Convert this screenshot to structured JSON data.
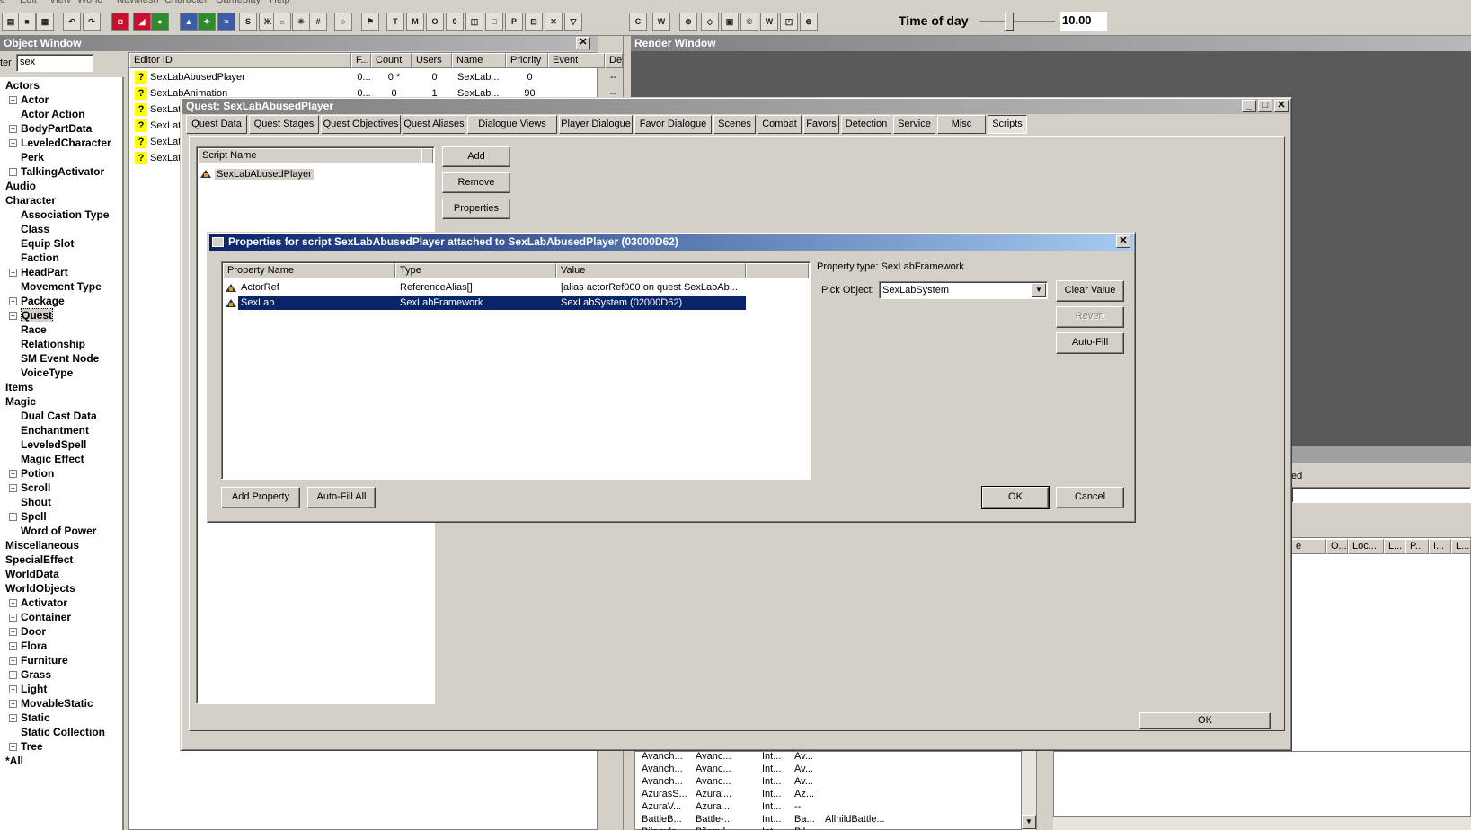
{
  "menu": {
    "items": [
      "e",
      "Edit",
      "View",
      "World",
      "NavMesh",
      "Character",
      "Gameplay",
      "Help"
    ]
  },
  "toolbar": {
    "time_of_day_label": "Time of day",
    "time_of_day_value": "10.00",
    "icons": [
      "open-icon",
      "save-icon",
      "preferences-icon",
      "undo-icon",
      "redo-icon",
      "select-icon",
      "landscape-edit-icon",
      "trees-icon",
      "sky-icon",
      "lighting-icon",
      "water-icon",
      "shk-icon",
      "dialogue-icon",
      "bulb-icon",
      "snap-icon",
      "grid-icon",
      "speech-icon",
      "marker-icon",
      "t-icon",
      "m-icon",
      "o-icon",
      "0-icon",
      "cube-icon",
      "box-icon",
      "p-icon",
      "portal-icon",
      "x-icon",
      "nav-icon",
      "c-icon",
      "w-icon",
      "misc-icon"
    ]
  },
  "object_window": {
    "title": "Object Window",
    "filter_label": "ter",
    "filter_value": "sex",
    "tree": [
      {
        "label": "Actors",
        "indent": 0,
        "expand": false
      },
      {
        "label": "Actor",
        "indent": 1,
        "expand": true
      },
      {
        "label": "Actor Action",
        "indent": 1,
        "expand": false
      },
      {
        "label": "BodyPartData",
        "indent": 1,
        "expand": true
      },
      {
        "label": "LeveledCharacter",
        "indent": 1,
        "expand": true
      },
      {
        "label": "Perk",
        "indent": 1,
        "expand": false
      },
      {
        "label": "TalkingActivator",
        "indent": 1,
        "expand": true
      },
      {
        "label": "Audio",
        "indent": 0,
        "expand": false
      },
      {
        "label": "Character",
        "indent": 0,
        "expand": false
      },
      {
        "label": "Association Type",
        "indent": 1,
        "expand": false
      },
      {
        "label": "Class",
        "indent": 1,
        "expand": false
      },
      {
        "label": "Equip Slot",
        "indent": 1,
        "expand": false
      },
      {
        "label": "Faction",
        "indent": 1,
        "expand": false
      },
      {
        "label": "HeadPart",
        "indent": 1,
        "expand": true
      },
      {
        "label": "Movement Type",
        "indent": 1,
        "expand": false
      },
      {
        "label": "Package",
        "indent": 1,
        "expand": true
      },
      {
        "label": "Quest",
        "indent": 1,
        "expand": true,
        "selected": true
      },
      {
        "label": "Race",
        "indent": 1,
        "expand": false
      },
      {
        "label": "Relationship",
        "indent": 1,
        "expand": false
      },
      {
        "label": "SM Event Node",
        "indent": 1,
        "expand": false
      },
      {
        "label": "VoiceType",
        "indent": 1,
        "expand": false
      },
      {
        "label": "Items",
        "indent": 0,
        "expand": false
      },
      {
        "label": "Magic",
        "indent": 0,
        "expand": false
      },
      {
        "label": "Dual Cast Data",
        "indent": 1,
        "expand": false
      },
      {
        "label": "Enchantment",
        "indent": 1,
        "expand": false
      },
      {
        "label": "LeveledSpell",
        "indent": 1,
        "expand": false
      },
      {
        "label": "Magic Effect",
        "indent": 1,
        "expand": false
      },
      {
        "label": "Potion",
        "indent": 1,
        "expand": true
      },
      {
        "label": "Scroll",
        "indent": 1,
        "expand": true
      },
      {
        "label": "Shout",
        "indent": 1,
        "expand": false
      },
      {
        "label": "Spell",
        "indent": 1,
        "expand": true
      },
      {
        "label": "Word of Power",
        "indent": 1,
        "expand": false
      },
      {
        "label": "Miscellaneous",
        "indent": 0,
        "expand": false
      },
      {
        "label": "SpecialEffect",
        "indent": 0,
        "expand": false
      },
      {
        "label": "WorldData",
        "indent": 0,
        "expand": false
      },
      {
        "label": "WorldObjects",
        "indent": 0,
        "expand": false
      },
      {
        "label": "Activator",
        "indent": 1,
        "expand": true
      },
      {
        "label": "Container",
        "indent": 1,
        "expand": true
      },
      {
        "label": "Door",
        "indent": 1,
        "expand": true
      },
      {
        "label": "Flora",
        "indent": 1,
        "expand": true
      },
      {
        "label": "Furniture",
        "indent": 1,
        "expand": true
      },
      {
        "label": "Grass",
        "indent": 1,
        "expand": true
      },
      {
        "label": "Light",
        "indent": 1,
        "expand": true
      },
      {
        "label": "MovableStatic",
        "indent": 1,
        "expand": true
      },
      {
        "label": "Static",
        "indent": 1,
        "expand": true
      },
      {
        "label": "Static Collection",
        "indent": 1,
        "expand": false
      },
      {
        "label": "Tree",
        "indent": 1,
        "expand": true
      },
      {
        "label": "*All",
        "indent": 0,
        "expand": false
      }
    ],
    "columns": [
      "Editor ID",
      "F...",
      "Count",
      "Users",
      "Name",
      "Priority",
      "Event",
      "Del"
    ],
    "rows": [
      {
        "id": "SexLabAbusedPlayer",
        "f": "0...",
        "count": "0 *",
        "users": "0",
        "name": "SexLab...",
        "priority": "0",
        "event": "",
        "del": "--"
      },
      {
        "id": "SexLabAnimation",
        "f": "0...",
        "count": "0",
        "users": "1",
        "name": "SexLab...",
        "priority": "90",
        "event": "",
        "del": "--"
      },
      {
        "id": "SexLat",
        "f": "",
        "count": "",
        "users": "",
        "name": "",
        "priority": "",
        "event": "",
        "del": ""
      },
      {
        "id": "SexLat",
        "f": "",
        "count": "",
        "users": "",
        "name": "",
        "priority": "",
        "event": "",
        "del": ""
      },
      {
        "id": "SexLat",
        "f": "",
        "count": "",
        "users": "",
        "name": "",
        "priority": "",
        "event": "",
        "del": ""
      },
      {
        "id": "SexLat",
        "f": "",
        "count": "",
        "users": "",
        "name": "",
        "priority": "",
        "event": "",
        "del": ""
      }
    ]
  },
  "render_window": {
    "title": "Render Window"
  },
  "background_right": {
    "partial_label": "ed",
    "columns": [
      "e",
      "O...",
      "Loc...",
      "L...",
      "P...",
      "I...",
      "L..."
    ]
  },
  "background_bottom_list": {
    "rows": [
      [
        "Avanch...",
        "Avanc...",
        "Int...",
        "Av...",
        ""
      ],
      [
        "Avanch...",
        "Avanc...",
        "Int...",
        "Av...",
        ""
      ],
      [
        "Avanch...",
        "Avanc...",
        "Int...",
        "Av...",
        ""
      ],
      [
        "AzurasS...",
        "Azura'...",
        "Int...",
        "Az...",
        ""
      ],
      [
        "AzuraV...",
        "Azura ...",
        "Int...",
        "--",
        ""
      ],
      [
        "BattleB...",
        "Battle-...",
        "Int...",
        "Ba...",
        "AllhildBattle..."
      ],
      [
        "Bilegulc",
        "Bilegul",
        "Int",
        "Bil",
        ""
      ]
    ]
  },
  "quest": {
    "title": "Quest: SexLabAbusedPlayer",
    "tabs": [
      "Quest Data",
      "Quest Stages",
      "Quest Objectives",
      "Quest Aliases",
      "Dialogue Views",
      "Player Dialogue",
      "Favor Dialogue",
      "Scenes",
      "Combat",
      "Favors",
      "Detection",
      "Service",
      "Misc",
      "Scripts"
    ],
    "selected_tab": "Scripts",
    "script_list_header": "Script Name",
    "scripts": [
      "SexLabAbusedPlayer"
    ],
    "add_label": "Add",
    "remove_label": "Remove",
    "properties_label": "Properties",
    "ok_label": "OK"
  },
  "props": {
    "title": "Properties for script SexLabAbusedPlayer attached to SexLabAbusedPlayer (03000D62)",
    "columns": [
      "Property Name",
      "Type",
      "Value"
    ],
    "rows": [
      {
        "name": "ActorRef",
        "type": "ReferenceAlias[]",
        "value": "[alias actorRef000 on quest SexLabAb..."
      },
      {
        "name": "SexLab",
        "type": "SexLabFramework",
        "value": "SexLabSystem (02000D62)"
      }
    ],
    "selected_row": 1,
    "property_type_label": "Property type: SexLabFramework",
    "pick_object_label": "Pick Object:",
    "pick_object_value": "SexLabSystem",
    "clear_value_label": "Clear Value",
    "revert_label": "Revert",
    "autofill_label": "Auto-Fill",
    "add_property_label": "Add Property",
    "autofill_all_label": "Auto-Fill All",
    "ok_label": "OK",
    "cancel_label": "Cancel"
  },
  "colors": {
    "selection": "#0a246a",
    "active_title": "#0a246a",
    "warning_yellow": "#ffff00"
  }
}
